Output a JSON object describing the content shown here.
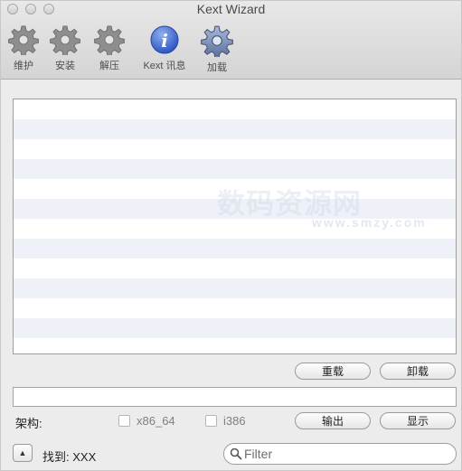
{
  "window": {
    "title": "Kext Wizard"
  },
  "toolbar": {
    "items": [
      {
        "label": "维护",
        "icon": "gear-icon"
      },
      {
        "label": "安装",
        "icon": "gear-icon"
      },
      {
        "label": "解压",
        "icon": "gear-icon"
      },
      {
        "label": "Kext 讯息",
        "icon": "info-icon"
      },
      {
        "label": "加载",
        "icon": "gear-icon"
      }
    ]
  },
  "list": {
    "rows": []
  },
  "watermark": {
    "text": "数码资源网",
    "sub": "www.smzy.com"
  },
  "buttons": {
    "reload": "重载",
    "unload": "卸载",
    "export": "输出",
    "show": "显示"
  },
  "arch": {
    "label": "架构:",
    "options": [
      {
        "label": "x86_64",
        "checked": false
      },
      {
        "label": "i386",
        "checked": false
      }
    ]
  },
  "footer": {
    "found_label": "找到: XXX",
    "disclosure_glyph": "▲"
  },
  "search": {
    "placeholder": "Filter",
    "value": ""
  },
  "colors": {
    "stripe": "#eef2f8",
    "info_accent": "#3b67c9"
  }
}
